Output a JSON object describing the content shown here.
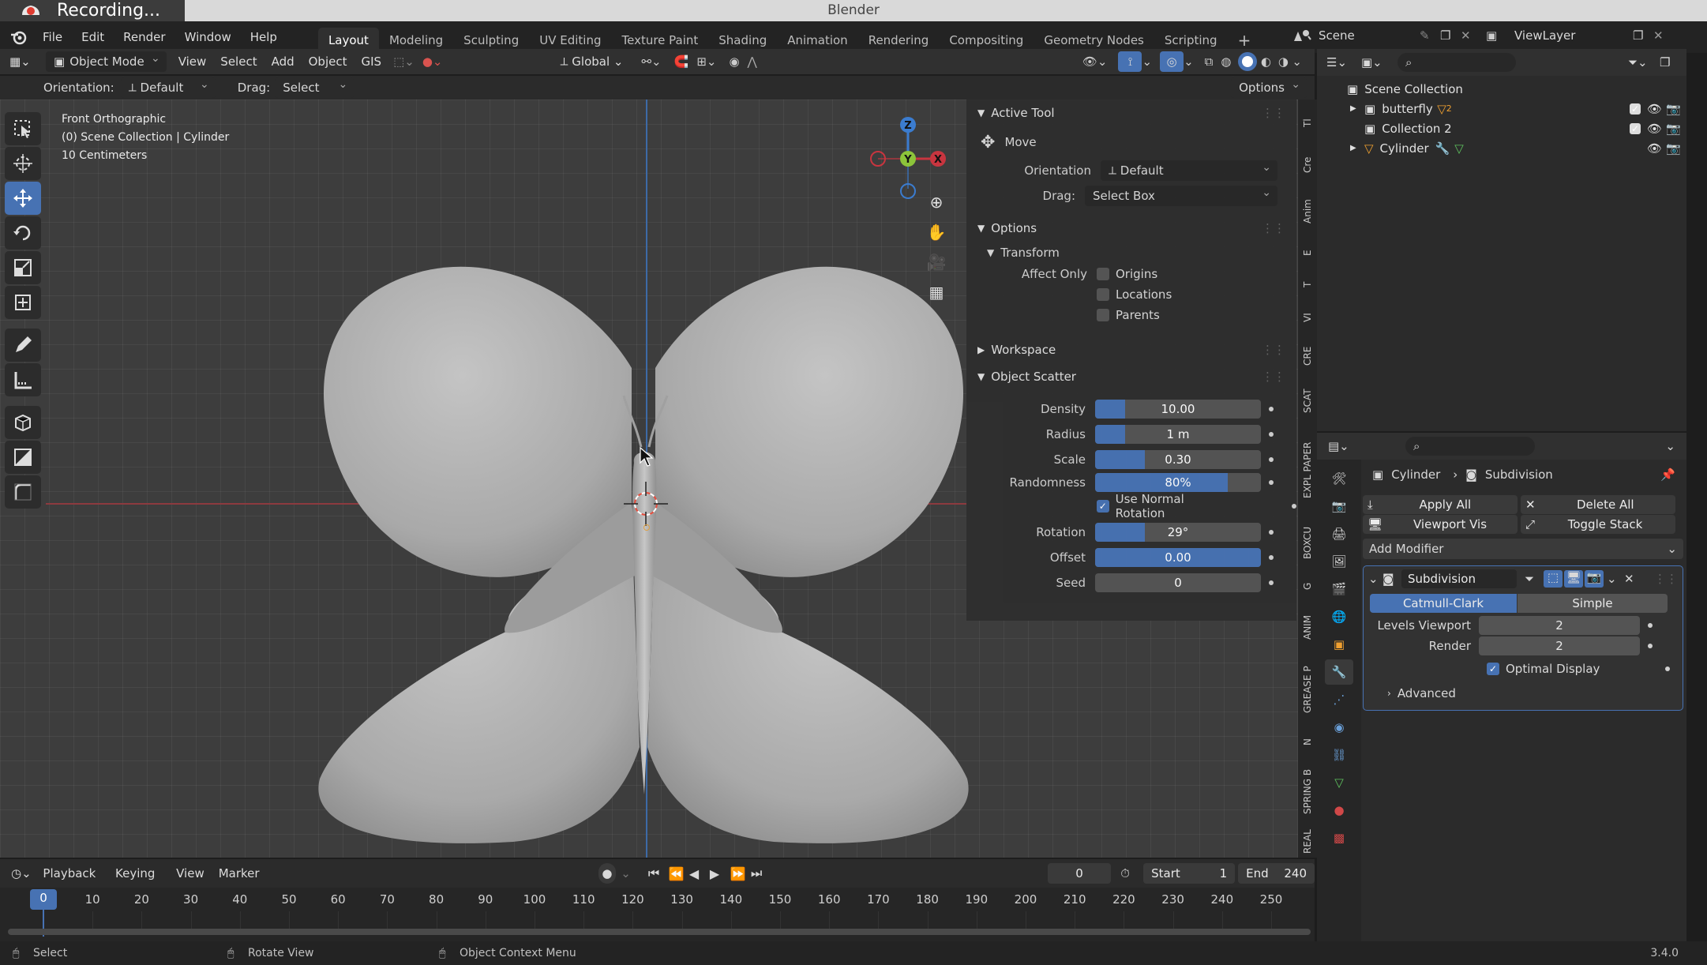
{
  "window": {
    "recording_label": "Recording...",
    "title": "Blender",
    "version": "3.4.0"
  },
  "menu": {
    "items": [
      "File",
      "Edit",
      "Render",
      "Window",
      "Help"
    ]
  },
  "workspaces": [
    "Layout",
    "Modeling",
    "Sculpting",
    "UV Editing",
    "Texture Paint",
    "Shading",
    "Animation",
    "Rendering",
    "Compositing",
    "Geometry Nodes",
    "Scripting"
  ],
  "workspace_active": "Layout",
  "scene": {
    "name": "Scene",
    "view_layer": "ViewLayer"
  },
  "header": {
    "mode": "Object Mode",
    "menus": [
      "View",
      "Select",
      "Add",
      "Object",
      "GIS"
    ],
    "transform_orientation": "Global",
    "options_label": "Options"
  },
  "tool_options": {
    "orientation_label": "Orientation:",
    "orientation_value": "Default",
    "drag_label": "Drag:",
    "drag_value": "Select Box"
  },
  "viewport": {
    "view_name": "Front Orthographic",
    "collection_path": "(0) Scene Collection | Cylinder",
    "scale_label": "10 Centimeters",
    "gizmo_axes": {
      "z": "Z",
      "y": "Y",
      "x": "X"
    }
  },
  "npanel": {
    "active_tool": {
      "title": "Active Tool",
      "tool_name": "Move",
      "orientation_label": "Orientation",
      "orientation_value": "Default",
      "drag_label": "Drag:",
      "drag_value": "Select Box"
    },
    "options": {
      "title": "Options",
      "transform_title": "Transform",
      "affect_only_label": "Affect Only",
      "origins": "Origins",
      "locations": "Locations",
      "parents": "Parents"
    },
    "workspace_title": "Workspace",
    "object_scatter": {
      "title": "Object Scatter",
      "density_label": "Density",
      "density_value": "10.00",
      "density_fill": 0.18,
      "radius_label": "Radius",
      "radius_value": "1 m",
      "radius_fill": 0.18,
      "scale_label": "Scale",
      "scale_value": "0.30",
      "scale_fill": 0.3,
      "randomness_label": "Randomness",
      "randomness_value": "80%",
      "randomness_fill": 0.8,
      "use_normal_rotation": "Use Normal Rotation",
      "rotation_label": "Rotation",
      "rotation_value": "29°",
      "rotation_fill": 0.3,
      "offset_label": "Offset",
      "offset_value": "0.00",
      "offset_fill": 1.0,
      "seed_label": "Seed",
      "seed_value": "0"
    }
  },
  "side_tabs": [
    "Tl",
    "Cre",
    "Anim",
    "E",
    "T",
    "VI",
    "CRE",
    "SCAT",
    "EXPL PAPER",
    "BOXCU",
    "G",
    "ANIM",
    "GREASE P",
    "N",
    "SPRING B",
    "REAL"
  ],
  "timeline": {
    "menus": [
      "Playback",
      "Keying",
      "View",
      "Marker"
    ],
    "current_frame": "0",
    "start_label": "Start",
    "start_value": "1",
    "end_label": "End",
    "end_value": "240",
    "ticks": [
      "0",
      "10",
      "20",
      "30",
      "40",
      "50",
      "60",
      "70",
      "80",
      "90",
      "100",
      "110",
      "120",
      "130",
      "140",
      "150",
      "160",
      "170",
      "180",
      "190",
      "200",
      "210",
      "220",
      "230",
      "240",
      "250"
    ]
  },
  "status": {
    "select": "Select",
    "rotate_view": "Rotate View",
    "context_menu": "Object Context Menu"
  },
  "outliner": {
    "root": "Scene Collection",
    "items": [
      {
        "name": "butterfly",
        "badge": "2"
      },
      {
        "name": "Collection 2"
      },
      {
        "name": "Cylinder"
      }
    ]
  },
  "properties": {
    "breadcrumb_object": "Cylinder",
    "breadcrumb_modifier": "Subdivision",
    "apply_all": "Apply All",
    "delete_all": "Delete All",
    "viewport_vis": "Viewport Vis",
    "toggle_stack": "Toggle Stack",
    "add_modifier": "Add Modifier",
    "modifier": {
      "name": "Subdivision",
      "type_catmull": "Catmull-Clark",
      "type_simple": "Simple",
      "levels_viewport_label": "Levels Viewport",
      "levels_viewport_value": "2",
      "render_label": "Render",
      "render_value": "2",
      "optimal_display": "Optimal Display",
      "advanced": "Advanced"
    }
  },
  "colors": {
    "accent": "#4772b3",
    "x_axis": "#c8353f",
    "y_axis": "#8cc43a",
    "z_axis": "#3b7ccf"
  }
}
